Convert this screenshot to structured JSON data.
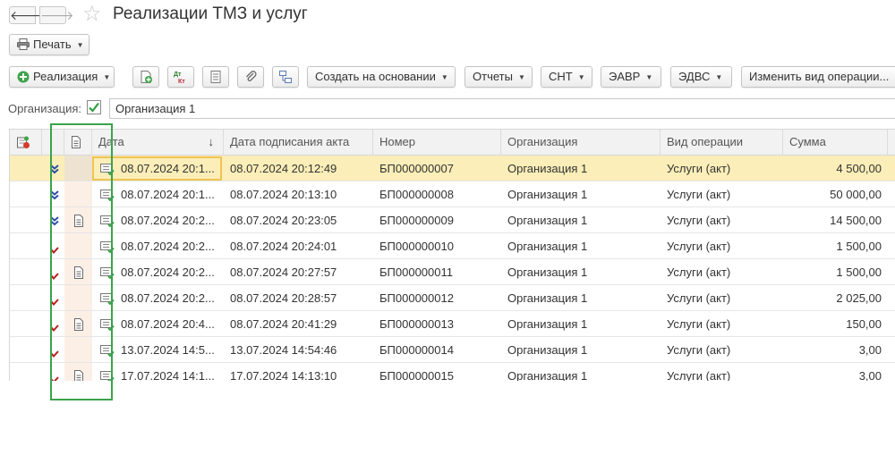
{
  "window": {
    "title": "Реализации ТМЗ и услуг"
  },
  "toolbar_print": {
    "label": "Печать"
  },
  "toolbar": {
    "create_label": "Реализация",
    "create_based_label": "Создать на основании",
    "reports_label": "Отчеты",
    "snt_label": "СНТ",
    "eavr_label": "ЭАВР",
    "edvs_label": "ЭДВС",
    "change_op_label": "Изменить вид операции..."
  },
  "filter": {
    "org_label": "Организация:",
    "org_value": "Организация 1"
  },
  "table": {
    "columns": [
      "Дата",
      "Дата подписания акта",
      "Номер",
      "Организация",
      "Вид операции",
      "Сумма"
    ],
    "rows": [
      {
        "date": "08.07.2024 20:1...",
        "signed": "08.07.2024 20:12:49",
        "number": "БП000000007",
        "org": "Организация 1",
        "op": "Услуги (акт)",
        "sum": "4 500,00",
        "status": "blue",
        "doc_icon": false,
        "selected": true
      },
      {
        "date": "08.07.2024 20:1...",
        "signed": "08.07.2024 20:13:10",
        "number": "БП000000008",
        "org": "Организация 1",
        "op": "Услуги (акт)",
        "sum": "50 000,00",
        "status": "blue",
        "doc_icon": false,
        "selected": false
      },
      {
        "date": "08.07.2024 20:2...",
        "signed": "08.07.2024 20:23:05",
        "number": "БП000000009",
        "org": "Организация 1",
        "op": "Услуги (акт)",
        "sum": "14 500,00",
        "status": "blue",
        "doc_icon": true,
        "selected": false
      },
      {
        "date": "08.07.2024 20:2...",
        "signed": "08.07.2024 20:24:01",
        "number": "БП000000010",
        "org": "Организация 1",
        "op": "Услуги (акт)",
        "sum": "1 500,00",
        "status": "red",
        "doc_icon": false,
        "selected": false
      },
      {
        "date": "08.07.2024 20:2...",
        "signed": "08.07.2024 20:27:57",
        "number": "БП000000011",
        "org": "Организация 1",
        "op": "Услуги (акт)",
        "sum": "1 500,00",
        "status": "red",
        "doc_icon": true,
        "selected": false
      },
      {
        "date": "08.07.2024 20:2...",
        "signed": "08.07.2024 20:28:57",
        "number": "БП000000012",
        "org": "Организация 1",
        "op": "Услуги (акт)",
        "sum": "2 025,00",
        "status": "red",
        "doc_icon": false,
        "selected": false
      },
      {
        "date": "08.07.2024 20:4...",
        "signed": "08.07.2024 20:41:29",
        "number": "БП000000013",
        "org": "Организация 1",
        "op": "Услуги (акт)",
        "sum": "150,00",
        "status": "red",
        "doc_icon": true,
        "selected": false
      },
      {
        "date": "13.07.2024 14:5...",
        "signed": "13.07.2024 14:54:46",
        "number": "БП000000014",
        "org": "Организация 1",
        "op": "Услуги (акт)",
        "sum": "3,00",
        "status": "red",
        "doc_icon": false,
        "selected": false
      },
      {
        "date": "17.07.2024 14:1...",
        "signed": "17.07.2024 14:13:10",
        "number": "БП000000015",
        "org": "Организация 1",
        "op": "Услуги (акт)",
        "sum": "3,00",
        "status": "red",
        "doc_icon": true,
        "selected": false
      }
    ]
  },
  "colors": {
    "accent_green": "#3aa34b",
    "selected_row": "#fbeeb8",
    "status_blue": "#2d4fa8",
    "status_red": "#b5201c"
  }
}
